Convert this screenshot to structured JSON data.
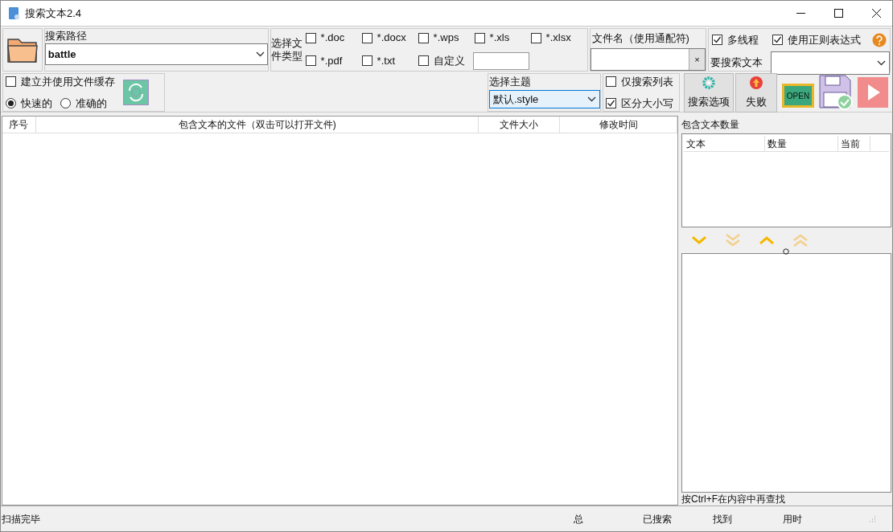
{
  "window": {
    "title": "搜索文本2.4"
  },
  "path": {
    "label": "搜索路径",
    "value": "battle"
  },
  "file_types": {
    "label": "选择文件类型",
    "items": [
      {
        "label": "*.doc",
        "checked": false
      },
      {
        "label": "*.docx",
        "checked": false
      },
      {
        "label": "*.wps",
        "checked": false
      },
      {
        "label": "*.xls",
        "checked": false
      },
      {
        "label": "*.xlsx",
        "checked": false
      },
      {
        "label": "*.pdf",
        "checked": false
      },
      {
        "label": "*.txt",
        "checked": false
      },
      {
        "label": "自定义",
        "checked": false
      }
    ]
  },
  "filename": {
    "label": "文件名（使用通配符)",
    "clear": "×"
  },
  "options": [
    {
      "label": "多线程",
      "checked": true
    },
    {
      "label": "使用正则表达式",
      "checked": true
    }
  ],
  "search_text": {
    "label": "要搜索文本"
  },
  "cache": {
    "label": "建立并使用文件缓存",
    "checked": false
  },
  "modes": [
    {
      "label": "快速的",
      "selected": true
    },
    {
      "label": "准确的",
      "selected": false
    }
  ],
  "theme": {
    "label": "选择主题",
    "value": "默认.style"
  },
  "search_flags": [
    {
      "label": "仅搜索列表",
      "checked": false
    },
    {
      "label": "区分大小写",
      "checked": true
    }
  ],
  "buttons": [
    {
      "label": "搜索选项",
      "kind": "gear"
    },
    {
      "label": "失败",
      "kind": "alert"
    }
  ],
  "open_sign": "OPEN",
  "table": {
    "columns": [
      "序号",
      "包含文本的文件（双击可以打开文件)",
      "文件大小",
      "修改时间"
    ]
  },
  "count_panel": {
    "title": "包含文本数量",
    "columns": [
      "文本",
      "数量",
      "当前"
    ]
  },
  "hint": "按Ctrl+F在内容中再查找",
  "status_bar": [
    "扫描完毕",
    "总",
    "已搜索",
    "找到",
    "用时"
  ]
}
